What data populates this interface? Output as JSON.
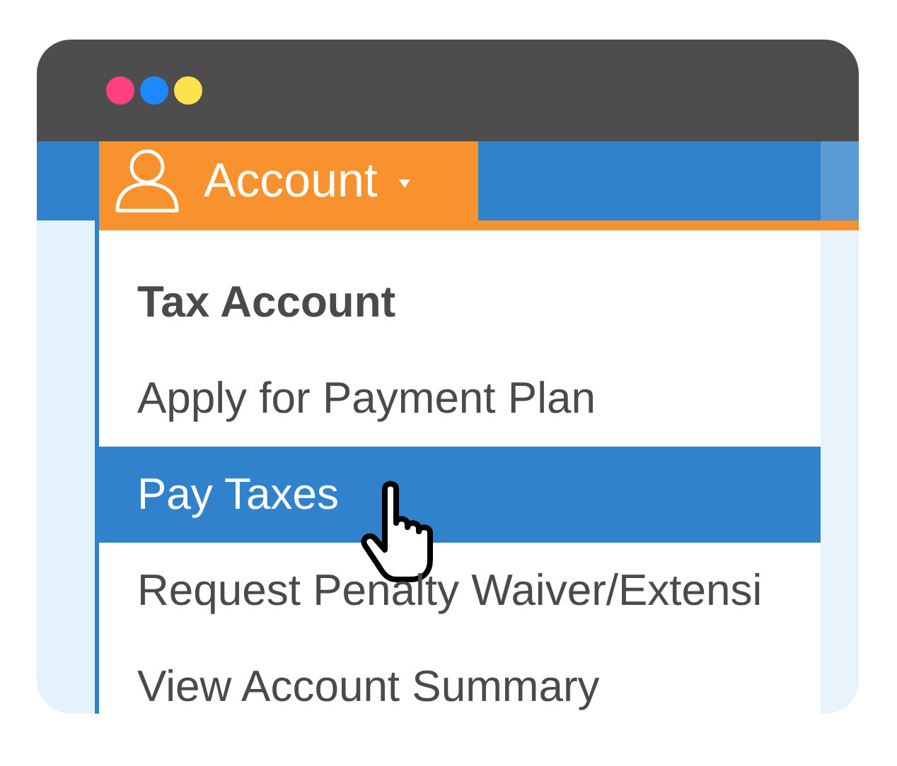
{
  "window": {
    "controls": [
      {
        "color": "#ff4081"
      },
      {
        "color": "#1e88ff"
      },
      {
        "color": "#ffe14d"
      }
    ]
  },
  "nav": {
    "menu_button": {
      "label": "Account"
    }
  },
  "menu_items": [
    {
      "kind": "heading",
      "label": "Tax Account",
      "selected": false
    },
    {
      "kind": "item",
      "label": "Apply for Payment Plan",
      "selected": false
    },
    {
      "kind": "item",
      "label": "Pay Taxes",
      "selected": true
    },
    {
      "kind": "item",
      "label": "Request Penalty Waiver/Extensi",
      "selected": false
    },
    {
      "kind": "item",
      "label": "View Account Summary",
      "selected": false
    }
  ]
}
